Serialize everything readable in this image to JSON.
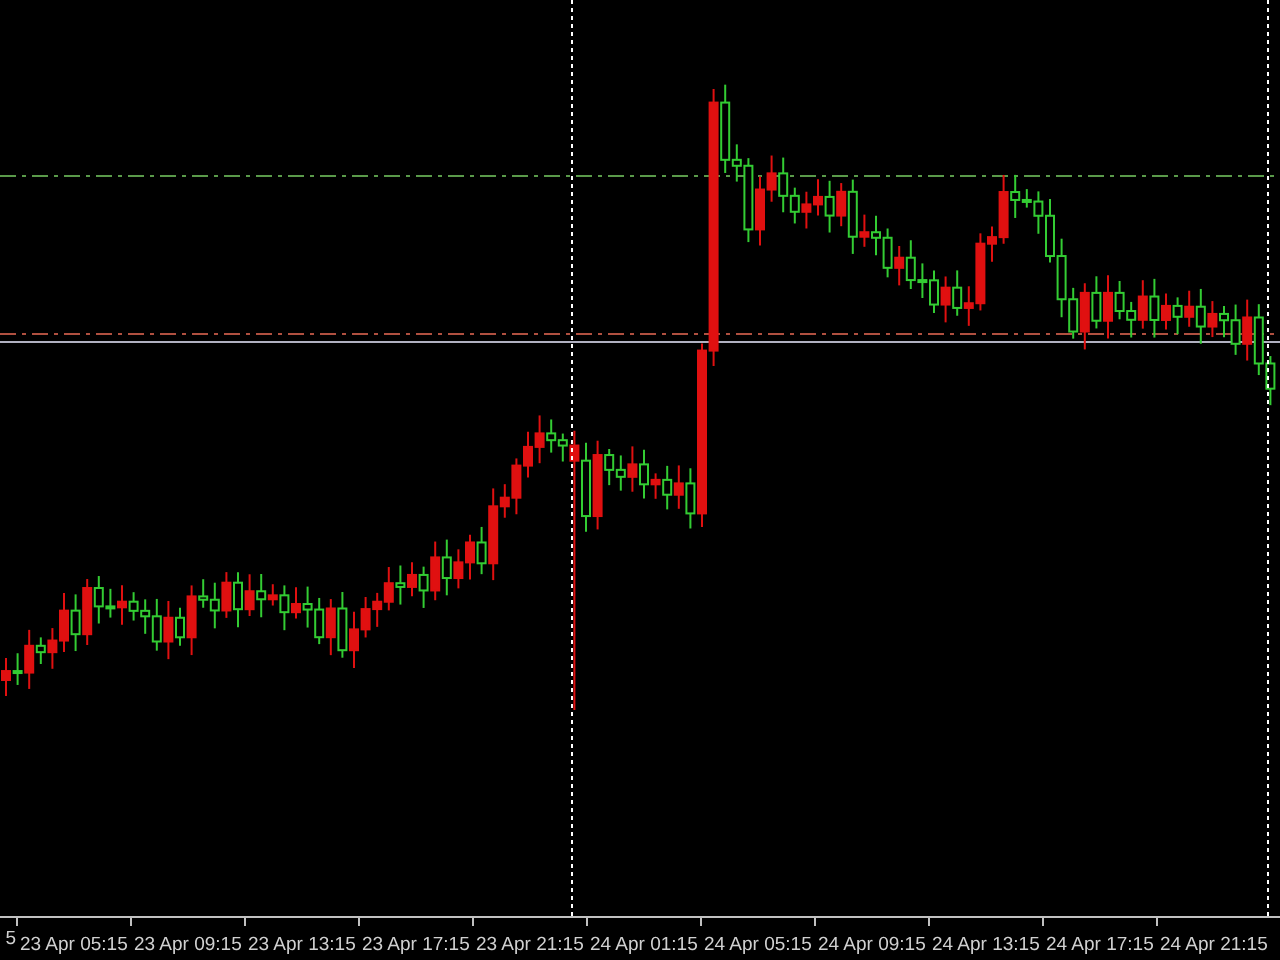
{
  "chart": {
    "time_axis_labels": [
      "5",
      "23 Apr 05:15",
      "23 Apr 09:15",
      "23 Apr 13:15",
      "23 Apr 17:15",
      "23 Apr 21:15",
      "24 Apr 01:15",
      "24 Apr 05:15",
      "24 Apr 09:15",
      "24 Apr 13:15",
      "24 Apr 17:15",
      "24 Apr 21:15"
    ]
  }
}
